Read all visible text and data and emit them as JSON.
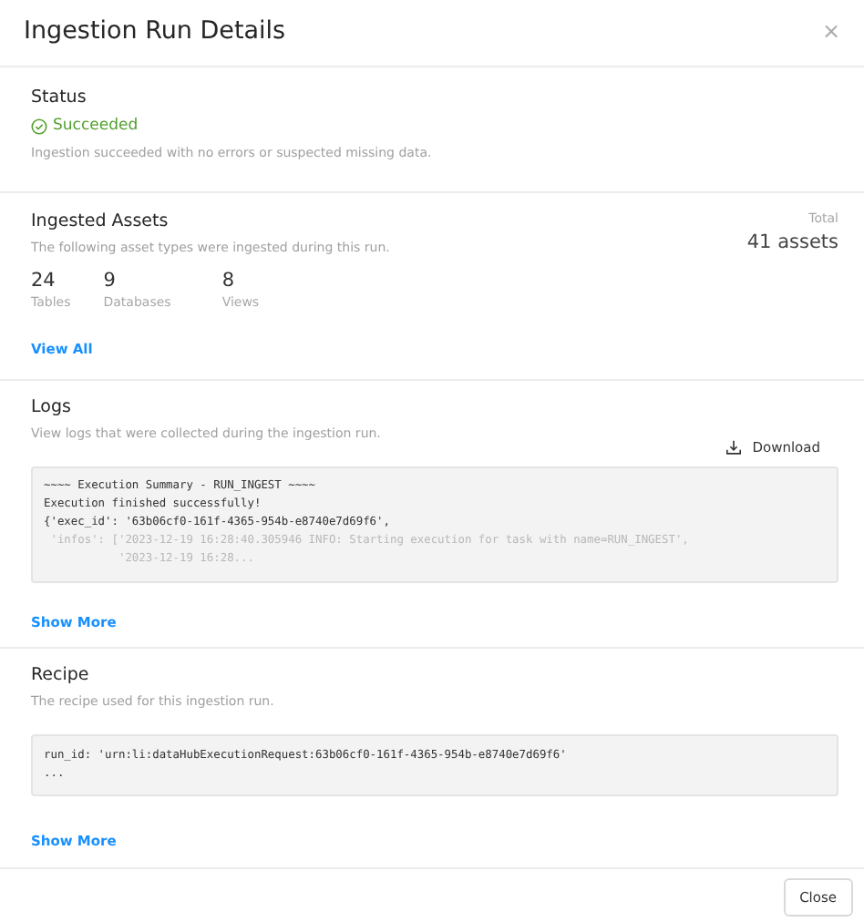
{
  "window": {
    "title": "Ingestion Run Details",
    "close_glyph": "×"
  },
  "status": {
    "heading": "Status",
    "ok": true,
    "label": "Succeeded",
    "description": "Ingestion succeeded with no errors or suspected missing data."
  },
  "assets": {
    "heading": "Ingested Assets",
    "description": "The following asset types were ingested during this run.",
    "total_label": "Total",
    "total_value": "41 assets",
    "counts": [
      {
        "value": "24",
        "label": "Tables"
      },
      {
        "value": "9",
        "label": "Databases"
      },
      {
        "value": "8",
        "label": "Views"
      }
    ],
    "link": "View All"
  },
  "logs": {
    "heading": "Logs",
    "description": "View logs that were collected during the ingestion run.",
    "download": "Download",
    "lines": [
      {
        "text": "~~~~ Execution Summary - RUN_INGEST ~~~~",
        "faded": false
      },
      {
        "text": "Execution finished successfully!",
        "faded": false
      },
      {
        "text": "{'exec_id': '63b06cf0-161f-4365-954b-e8740e7d69f6',",
        "faded": false
      },
      {
        "text": " 'infos': ['2023-12-19 16:28:40.305946 INFO: Starting execution for task with name=RUN_INGEST',",
        "faded": true
      },
      {
        "text": "           '2023-12-19 16:28...",
        "faded": true
      }
    ],
    "link": "Show More"
  },
  "recipe": {
    "heading": "Recipe",
    "description": "The recipe used for this ingestion run.",
    "lines": [
      {
        "text": "run_id: 'urn:li:dataHubExecutionRequest:63b06cf0-161f-4365-954b-e8740e7d69f6'",
        "faded": false
      },
      {
        "text": "...",
        "faded": false
      }
    ],
    "link": "Show More"
  },
  "footer": {
    "buttons": [
      "Close"
    ]
  }
}
